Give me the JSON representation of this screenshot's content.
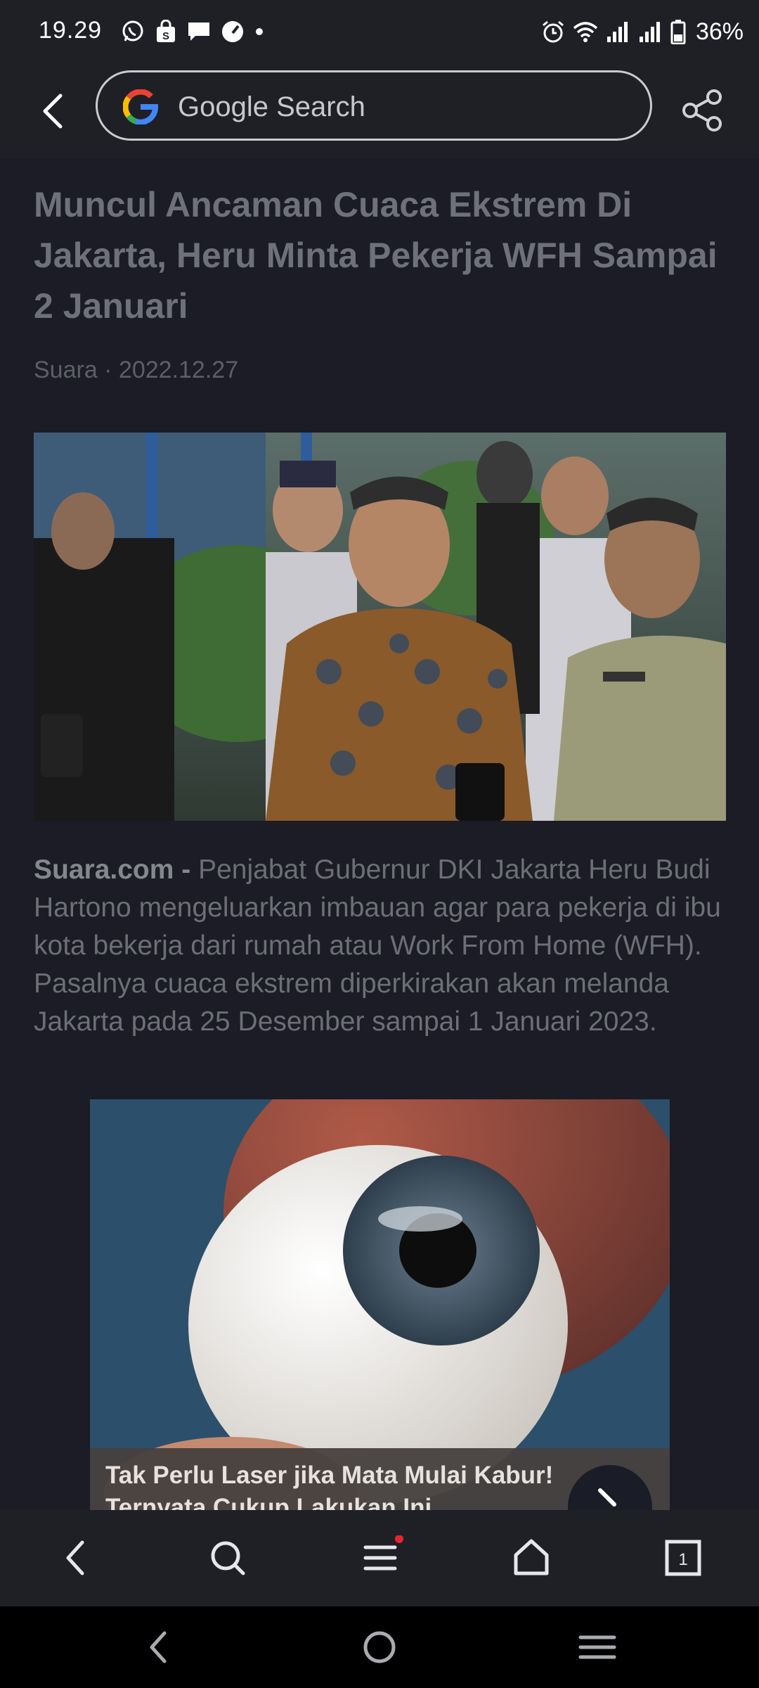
{
  "status_bar": {
    "time": "19.29",
    "battery": "36%",
    "left_icons": [
      "whatsapp-icon",
      "shopping-bag-icon",
      "message-icon",
      "speed-icon",
      "dot-icon"
    ],
    "right_icons": [
      "alarm-icon",
      "wifi-icon",
      "signal-icon",
      "signal-icon",
      "battery-icon"
    ]
  },
  "toolbar": {
    "search_label": "Google Search",
    "back_icon": "chevron-left-icon",
    "share_icon": "share-icon"
  },
  "article": {
    "title": "Muncul Ancaman Cuaca Ekstrem Di Jakarta, Heru Minta Pekerja WFH Sampai 2 Januari",
    "byline": "Suara · 2022.12.27",
    "source_label": "Suara.com -",
    "body": "Penjabat Gubernur DKI Jakarta Heru Budi Hartono mengeluarkan imbauan agar para pekerja di ibu kota bekerja dari rumah atau Work From Home (WFH). Pasalnya cuaca ekstrem diperkirakan akan melanda Jakarta pada 25 Desember sampai 1 Januari 2023."
  },
  "ad": {
    "title": "Tak Perlu Laser jika Mata Mulai Kabur! Ternyata Cukup Lakukan Ini"
  },
  "bottom_nav": {
    "tab_count": "1",
    "items": [
      "back-icon",
      "search-icon",
      "menu-icon",
      "home-icon",
      "tabs-icon"
    ]
  },
  "colors": {
    "background": "#1b1c26",
    "toolbar": "#1e2026",
    "notification_dot": "#e8242b"
  }
}
